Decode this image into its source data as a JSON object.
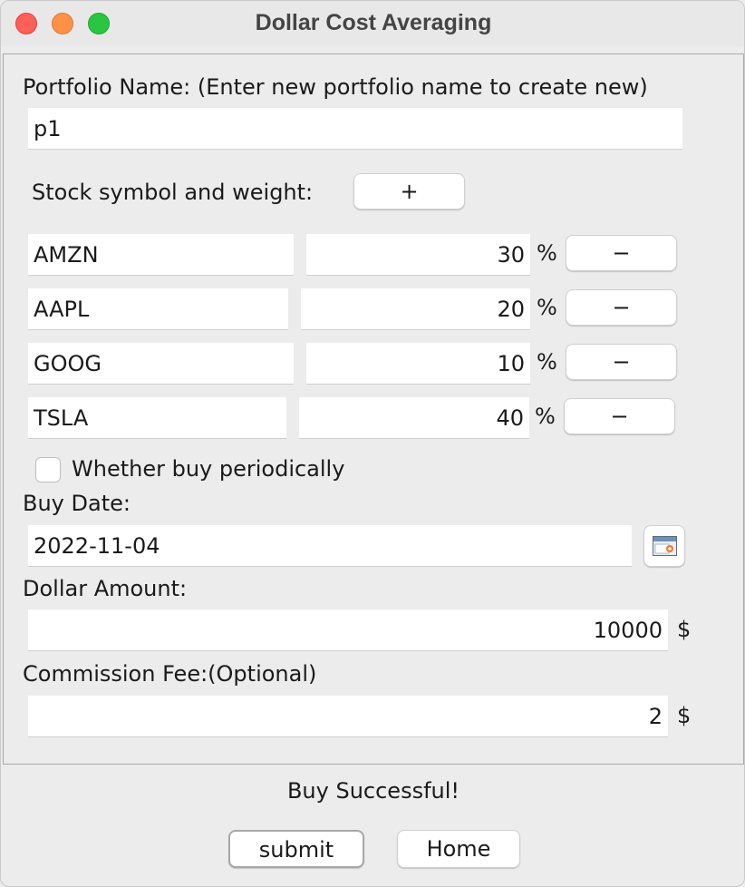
{
  "window": {
    "title": "Dollar Cost Averaging",
    "traffic_lights": {
      "close": "#fe5f57",
      "minimize": "#fe9148",
      "maximize": "#29c63f"
    }
  },
  "form": {
    "portfolio_label": "Portfolio Name: (Enter new portfolio name to create new)",
    "portfolio_name": "p1",
    "stock_label": "Stock symbol and weight:",
    "add_label": "+",
    "remove_label": "−",
    "percent_sign": "%",
    "stocks": [
      {
        "symbol": "AMZN",
        "weight": "30"
      },
      {
        "symbol": "AAPL",
        "weight": "20"
      },
      {
        "symbol": "GOOG",
        "weight": "10"
      },
      {
        "symbol": "TSLA",
        "weight": "40"
      }
    ],
    "periodic_label": "Whether buy periodically",
    "periodic_checked": false,
    "buy_date_label": "Buy Date:",
    "buy_date": "2022-11-04",
    "calendar_icon": "calendar-icon",
    "dollar_amount_label": "Dollar Amount:",
    "dollar_amount": "10000",
    "currency": "$",
    "commission_label": "Commission Fee:(Optional)",
    "commission_fee": "2"
  },
  "footer": {
    "status": "Buy Successful!",
    "submit_label": "submit",
    "home_label": "Home"
  }
}
